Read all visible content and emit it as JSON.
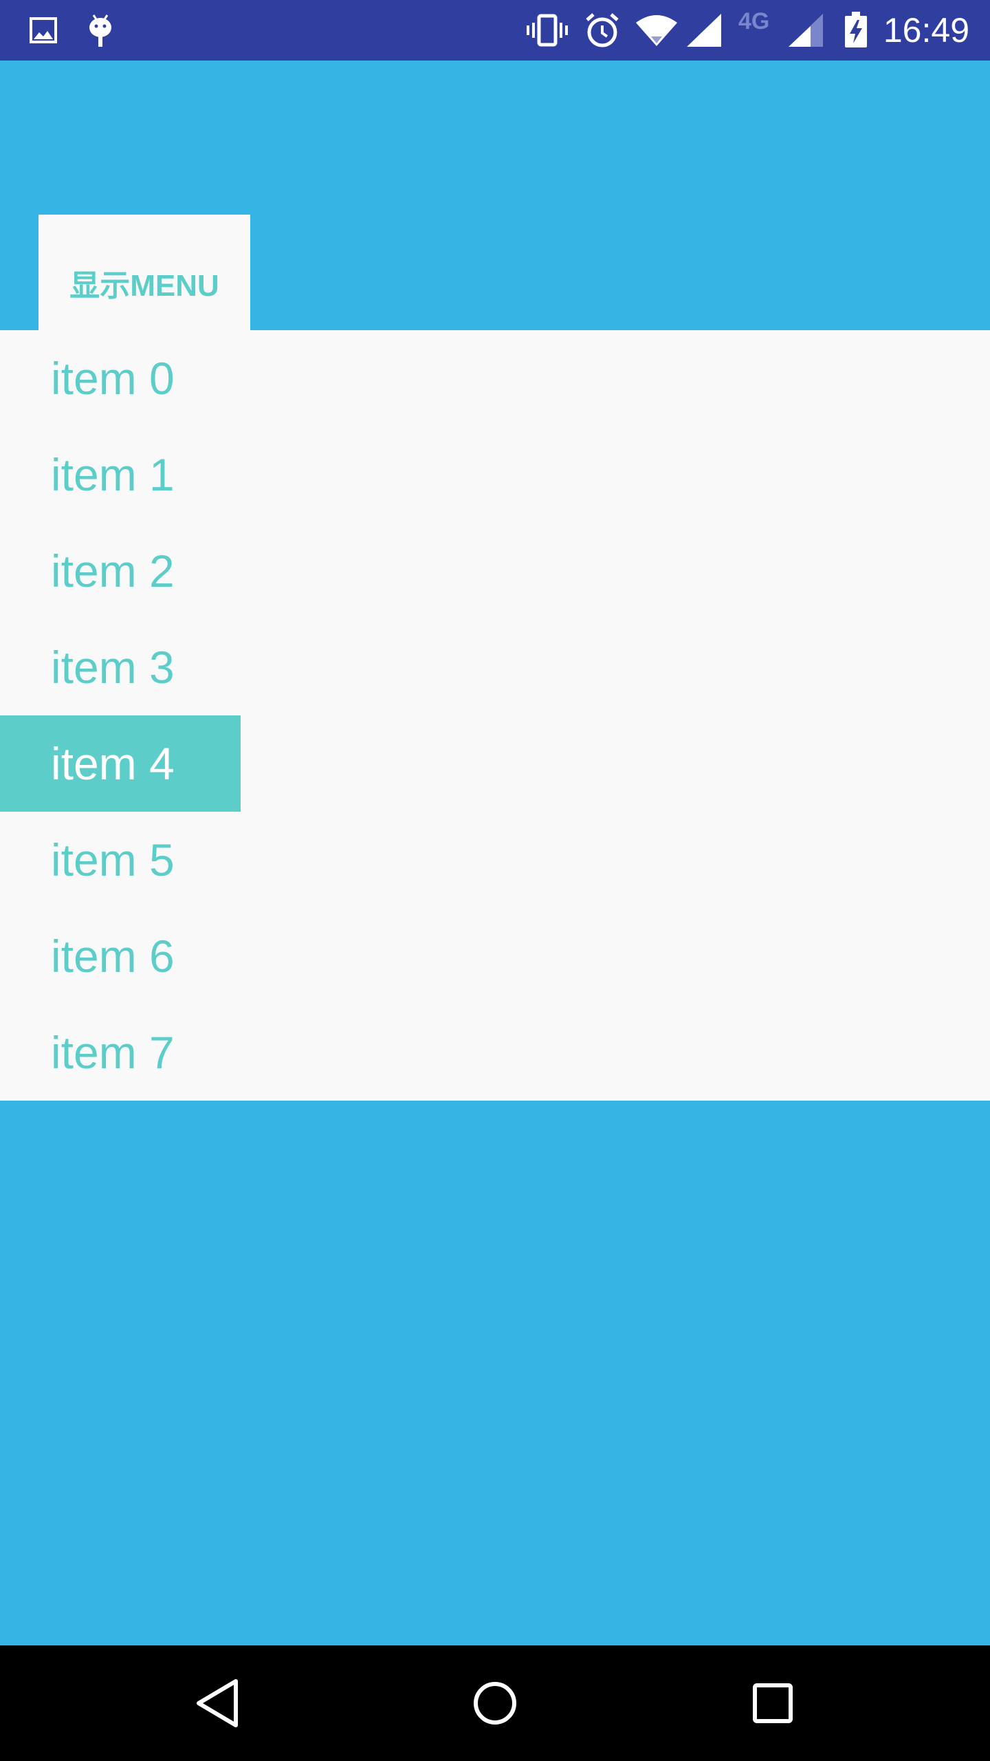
{
  "status_bar": {
    "time": "16:49",
    "network_label": "4G",
    "icons": [
      "image-icon",
      "android-icon",
      "vibrate-icon",
      "alarm-icon",
      "wifi-icon",
      "signal-icon",
      "signal-4g-icon",
      "battery-charging-icon"
    ]
  },
  "menu_button": {
    "label": "显示MENU"
  },
  "menu": {
    "items": [
      {
        "label": "item 0",
        "selected": false
      },
      {
        "label": "item 1",
        "selected": false
      },
      {
        "label": "item 2",
        "selected": false
      },
      {
        "label": "item 3",
        "selected": false
      },
      {
        "label": "item 4",
        "selected": true
      },
      {
        "label": "item 5",
        "selected": false
      },
      {
        "label": "item 6",
        "selected": false
      },
      {
        "label": "item 7",
        "selected": false
      }
    ]
  },
  "nav_bar": {
    "icons": [
      "back-icon",
      "home-icon",
      "recents-icon"
    ]
  },
  "colors": {
    "status_bar": "#303f9f",
    "background": "#35b5e5",
    "menu_background": "#f9f9f9",
    "accent": "#5ccdc9",
    "selected_text": "#ffffff",
    "nav_bar": "#000000"
  }
}
